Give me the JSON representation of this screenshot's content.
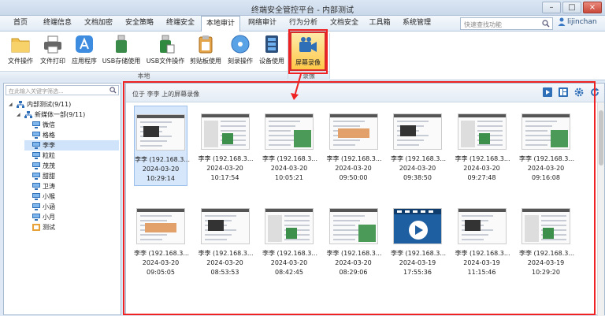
{
  "window": {
    "title": "终端安全管控平台 - 内部测试"
  },
  "menu": {
    "items": [
      "首页",
      "终端信息",
      "文档加密",
      "安全策略",
      "终端安全",
      "本地审计",
      "网络审计",
      "行为分析",
      "文档安全",
      "工具箱",
      "系统管理"
    ],
    "active_index": 5,
    "search_placeholder": "快速查找功能",
    "user": "lijinchan"
  },
  "ribbon": {
    "buttons": [
      "文件操作",
      "文件打印",
      "应用程序",
      "USB存储使用",
      "USB文件操作",
      "剪贴板使用",
      "刻录操作",
      "设备使用",
      "屏幕录像"
    ],
    "selected": "屏幕录像",
    "groups": [
      "本地",
      "录像"
    ]
  },
  "left": {
    "filter_placeholder": "在此输入关键字筛选...",
    "tree": [
      {
        "label": "内部测试(9/11)",
        "level": 0,
        "icon": "org-icon"
      },
      {
        "label": "新媒体一部(9/11)",
        "level": 1,
        "icon": "org-icon"
      },
      {
        "label": "微信",
        "level": 2,
        "icon": "computer-icon"
      },
      {
        "label": "格格",
        "level": 2,
        "icon": "computer-icon"
      },
      {
        "label": "李李",
        "level": 2,
        "icon": "computer-icon",
        "selected": true
      },
      {
        "label": "粒粒",
        "level": 2,
        "icon": "computer-icon"
      },
      {
        "label": "茂茂",
        "level": 2,
        "icon": "computer-icon"
      },
      {
        "label": "甜甜",
        "level": 2,
        "icon": "computer-icon"
      },
      {
        "label": "卫涛",
        "level": 2,
        "icon": "computer-icon"
      },
      {
        "label": "小猴",
        "level": 2,
        "icon": "computer-icon"
      },
      {
        "label": "小涵",
        "level": 2,
        "icon": "computer-icon"
      },
      {
        "label": "小月",
        "level": 2,
        "icon": "computer-icon"
      },
      {
        "label": "测试",
        "level": 2,
        "icon": "user-icon"
      }
    ]
  },
  "main": {
    "path": "位于 李李 上的屏幕录像",
    "recordings": [
      {
        "name": "李李 (192.168.3...",
        "date": "2024-03-20",
        "time": "10:29:14",
        "selected": true
      },
      {
        "name": "李李 (192.168.3...",
        "date": "2024-03-20",
        "time": "10:17:54"
      },
      {
        "name": "李李 (192.168.3...",
        "date": "2024-03-20",
        "time": "10:05:21"
      },
      {
        "name": "李李 (192.168.3...",
        "date": "2024-03-20",
        "time": "09:50:00"
      },
      {
        "name": "李李 (192.168.3...",
        "date": "2024-03-20",
        "time": "09:38:50"
      },
      {
        "name": "李李 (192.168.3...",
        "date": "2024-03-20",
        "time": "09:27:48"
      },
      {
        "name": "李李 (192.168.3...",
        "date": "2024-03-20",
        "time": "09:16:08"
      },
      {
        "name": "李李 (192.168.3...",
        "date": "2024-03-20",
        "time": "09:05:05"
      },
      {
        "name": "李李 (192.168.3...",
        "date": "2024-03-20",
        "time": "08:53:53"
      },
      {
        "name": "李李 (192.168.3...",
        "date": "2024-03-20",
        "time": "08:42:45"
      },
      {
        "name": "李李 (192.168.3...",
        "date": "2024-03-20",
        "time": "08:29:06"
      },
      {
        "name": "李李 (192.168.3...",
        "date": "2024-03-19",
        "time": "17:55:36",
        "video": true
      },
      {
        "name": "李李 (192.168.3...",
        "date": "2024-03-19",
        "time": "11:15:46"
      },
      {
        "name": "李李 (192.168.3...",
        "date": "2024-03-19",
        "time": "10:29:20"
      }
    ]
  },
  "colors": {
    "highlight": "#e22222",
    "accent": "#2f6fb8"
  }
}
